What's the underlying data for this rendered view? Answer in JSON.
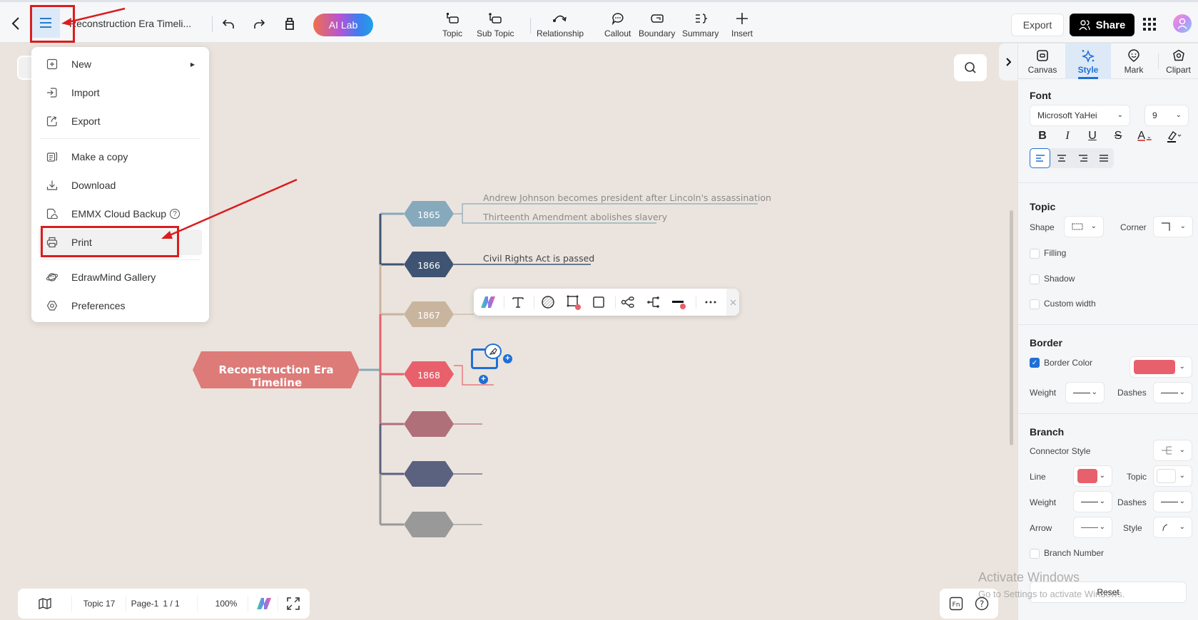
{
  "topbar": {
    "title": "Reconstruction Era Timeli...",
    "ai_lab": "AI Lab",
    "tools": [
      {
        "label": "Topic",
        "icon": "topic-icon"
      },
      {
        "label": "Sub Topic",
        "icon": "subtopic-icon"
      },
      {
        "label": "Relationship",
        "icon": "relationship-icon"
      },
      {
        "label": "Callout",
        "icon": "callout-icon"
      },
      {
        "label": "Boundary",
        "icon": "boundary-icon"
      },
      {
        "label": "Summary",
        "icon": "summary-icon"
      },
      {
        "label": "Insert",
        "icon": "plus-icon"
      }
    ],
    "export_label": "Export",
    "share_label": "Share"
  },
  "menu": {
    "items": [
      {
        "label": "New",
        "icon": "new-file-icon",
        "submenu": true
      },
      {
        "label": "Import",
        "icon": "import-icon"
      },
      {
        "label": "Export",
        "icon": "export-icon"
      },
      {
        "label": "Make a copy",
        "icon": "copy-icon"
      },
      {
        "label": "Download",
        "icon": "download-icon"
      },
      {
        "label": "EMMX Cloud Backup",
        "icon": "cloud-backup-icon",
        "help": "?"
      },
      {
        "label": "Print",
        "icon": "printer-icon",
        "highlighted": true
      },
      {
        "label": "EdrawMind Gallery",
        "icon": "gallery-icon"
      },
      {
        "label": "Preferences",
        "icon": "preferences-icon"
      }
    ]
  },
  "mindmap": {
    "root": {
      "label": "Reconstruction Era Timeline",
      "color": "#dd7b78"
    },
    "branches": [
      {
        "label": "1865",
        "color": "#87a9bc",
        "subtopics": [
          "Andrew Johnson becomes president after Lincoln's assassination",
          "Thirteenth Amendment abolishes slavery"
        ]
      },
      {
        "label": "1866",
        "color": "#3e5472",
        "subtopics": [
          "Civil Rights Act is passed"
        ]
      },
      {
        "label": "1867",
        "color": "#c9b49e",
        "subtopics": []
      },
      {
        "label": "1868",
        "color": "#e8606c",
        "subtopics": [
          ""
        ],
        "selected": true
      },
      {
        "label": "",
        "color": "#b07079",
        "subtopics": []
      },
      {
        "label": "",
        "color": "#5b6280",
        "subtopics": []
      },
      {
        "label": "",
        "color": "#999999",
        "subtopics": []
      }
    ]
  },
  "floating_toolbar": {
    "items": [
      "ai-icon",
      "text-icon",
      "fill-icon",
      "border-icon",
      "shape-icon",
      "layout-icon",
      "connector-icon",
      "line-color-icon",
      "more-icon"
    ]
  },
  "panel": {
    "tabs": [
      {
        "label": "Canvas"
      },
      {
        "label": "Style",
        "active": true
      },
      {
        "label": "Mark"
      },
      {
        "label": "Clipart"
      }
    ],
    "font": {
      "title": "Font",
      "family": "Microsoft YaHei",
      "size": "9",
      "format": [
        "B",
        "I",
        "U",
        "S",
        "A"
      ],
      "align_active": "left"
    },
    "topic": {
      "title": "Topic",
      "shape_label": "Shape",
      "corner_label": "Corner",
      "filling": {
        "label": "Filling",
        "checked": false
      },
      "shadow": {
        "label": "Shadow",
        "checked": false
      },
      "custom_width": {
        "label": "Custom width",
        "checked": false
      }
    },
    "border": {
      "title": "Border",
      "border_color": {
        "label": "Border Color",
        "checked": true,
        "color": "#e8606c"
      },
      "weight_label": "Weight",
      "dashes_label": "Dashes"
    },
    "branch": {
      "title": "Branch",
      "connector_style_label": "Connector Style",
      "line_label": "Line",
      "line_color": "#e8606c",
      "topic_label": "Topic",
      "topic_color": "#ffffff",
      "weight_label": "Weight",
      "dashes_label": "Dashes",
      "arrow_label": "Arrow",
      "style_label": "Style",
      "branch_number": {
        "label": "Branch Number",
        "checked": false
      }
    },
    "reset_label": "Reset"
  },
  "bottombar": {
    "topic_count": "Topic 17",
    "page": "Page-1",
    "page_count": "1 / 1",
    "zoom": "100%"
  },
  "watermark": {
    "line1": "Activate Windows",
    "line2": "Go to Settings to activate Windows."
  }
}
